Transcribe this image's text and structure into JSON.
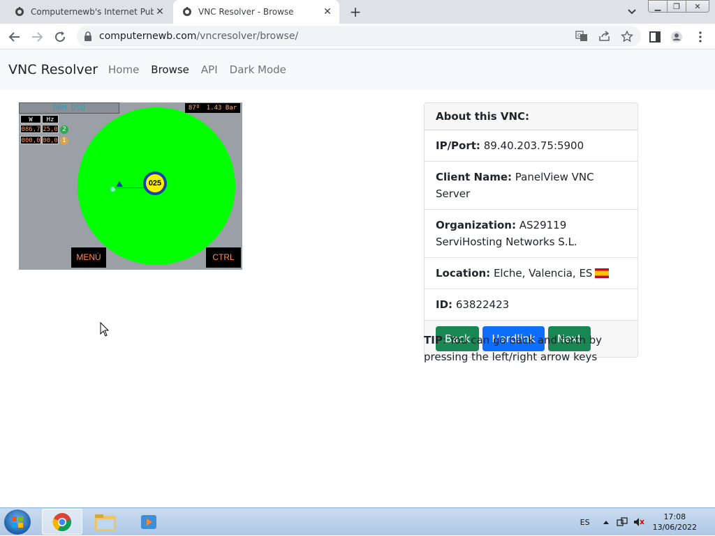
{
  "browser": {
    "tabs": [
      {
        "title": "Computernewb's Internet Pub H",
        "active": false
      },
      {
        "title": "VNC Resolver - Browse",
        "active": true
      }
    ],
    "new_tab": "+",
    "url_host": "computernewb.com",
    "url_path": "/vncresolver/browse/"
  },
  "navbar": {
    "brand": "VNC Resolver",
    "links": [
      "Home",
      "Browse",
      "API",
      "Dark Mode"
    ],
    "active": "Browse"
  },
  "vnc_screen": {
    "title": "DBM DSO",
    "readout_temp": "87º",
    "readout_pressure": "1.43 Bar",
    "col_w": "W",
    "col_hz": "Hz",
    "row1_w": "086,7",
    "row1_hz": "25,0",
    "row1_badge": "2",
    "row2_w": "000,0",
    "row2_hz": "00,0",
    "row2_badge": "1",
    "gauge_value": "025",
    "menu_label": "MENÚ",
    "ctrl_label": "CTRL"
  },
  "about": {
    "header": "About this VNC:",
    "ip_label": "IP/Port:",
    "ip_value": "89.40.203.75:5900",
    "client_label": "Client Name:",
    "client_value": "PanelView VNC Server",
    "org_label": "Organization:",
    "org_value": "AS29119 ServiHosting Networks S.L.",
    "location_label": "Location:",
    "location_value": "Elche, Valencia, ES",
    "id_label": "ID:",
    "id_value": "63822423",
    "buttons": {
      "back": "Back",
      "hardlink": "Hardlink",
      "next": "Next"
    }
  },
  "tip": {
    "label": "TIP",
    "text": ": You can go back and forth by pressing the left/right arrow keys"
  },
  "taskbar": {
    "language": "ES",
    "time": "17:08",
    "date": "13/06/2022"
  },
  "colors": {
    "green_button": "#198754",
    "blue_button": "#0d6efd",
    "vnc_circle": "#00ff00"
  }
}
